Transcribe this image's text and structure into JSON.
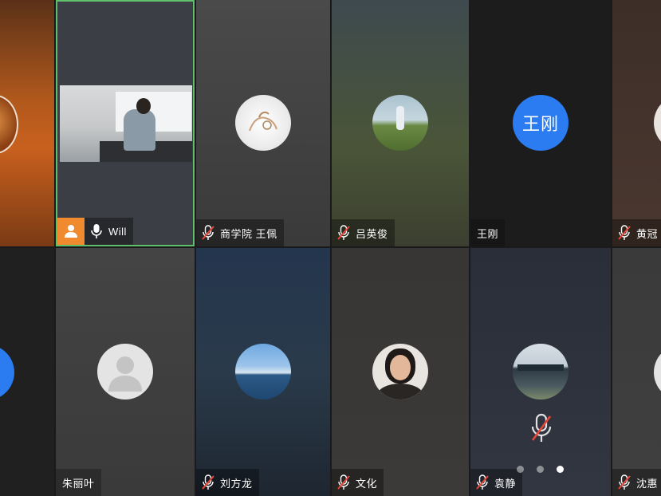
{
  "participants_row1": [
    {
      "name": "",
      "muted": false
    },
    {
      "name": "Will",
      "muted": false,
      "speaking": true,
      "host": true
    },
    {
      "name": "商学院 王佩",
      "muted": true
    },
    {
      "name": "吕英俊",
      "muted": true
    },
    {
      "name": "王刚",
      "muted": false,
      "avatar_text": "王刚"
    },
    {
      "name": "黄冠",
      "muted": true
    }
  ],
  "participants_row2": [
    {
      "name": "",
      "muted": false
    },
    {
      "name": "朱丽叶",
      "muted": false
    },
    {
      "name": "刘方龙",
      "muted": true
    },
    {
      "name": "文化",
      "muted": true
    },
    {
      "name": "袁静",
      "muted": true
    },
    {
      "name": "沈惠",
      "muted": true
    }
  ],
  "pagination": {
    "count": 3,
    "active_index": 2
  },
  "colors": {
    "speaking_border": "#5fbf6b",
    "host_badge": "#f08a2e",
    "text_avatar_bg": "#2b7cf0"
  }
}
